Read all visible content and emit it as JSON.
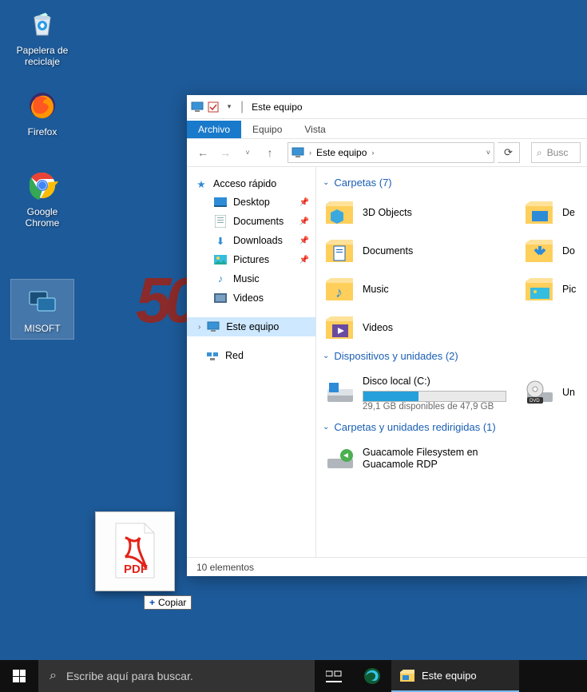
{
  "desktop": {
    "icons": [
      {
        "name": "recycle-bin",
        "label": "Papelera de reciclaje"
      },
      {
        "name": "firefox",
        "label": "Firefox"
      },
      {
        "name": "chrome",
        "label": "Google Chrome"
      },
      {
        "name": "misoft",
        "label": "MISOFT"
      }
    ],
    "wallpaper_text": "50"
  },
  "drag": {
    "file_type": "PDF",
    "cursor_label": "Copiar"
  },
  "explorer": {
    "title": "Este equipo",
    "tabs": {
      "file": "Archivo",
      "computer": "Equipo",
      "view": "Vista"
    },
    "nav": {
      "back": "←",
      "forward": "→",
      "up": "↑"
    },
    "breadcrumb": {
      "root": "Este equipo"
    },
    "search_placeholder": "Busc",
    "sidebar": {
      "quick": {
        "label": "Acceso rápido",
        "items": [
          {
            "label": "Desktop",
            "icon": "desktop"
          },
          {
            "label": "Documents",
            "icon": "documents"
          },
          {
            "label": "Downloads",
            "icon": "downloads"
          },
          {
            "label": "Pictures",
            "icon": "pictures"
          },
          {
            "label": "Music",
            "icon": "music"
          },
          {
            "label": "Videos",
            "icon": "videos"
          }
        ]
      },
      "this_pc": "Este equipo",
      "network": "Red"
    },
    "groups": {
      "folders": {
        "label": "Carpetas (7)",
        "items": [
          {
            "label": "3D Objects"
          },
          {
            "label": "De"
          },
          {
            "label": "Documents"
          },
          {
            "label": "Do"
          },
          {
            "label": "Music"
          },
          {
            "label": "Pic"
          },
          {
            "label": "Videos"
          }
        ]
      },
      "devices": {
        "label": "Dispositivos y unidades (2)",
        "items": [
          {
            "label": "Disco local (C:)",
            "sub": "29,1 GB disponibles de 47,9 GB",
            "fill": 0.39
          },
          {
            "label": "Un"
          }
        ]
      },
      "redirected": {
        "label": "Carpetas y unidades redirigidas (1)",
        "items": [
          {
            "label": "Guacamole Filesystem en Guacamole RDP"
          }
        ]
      }
    },
    "status": "10 elementos"
  },
  "taskbar": {
    "search_placeholder": "Escribe aquí para buscar.",
    "active_window": "Este equipo"
  }
}
